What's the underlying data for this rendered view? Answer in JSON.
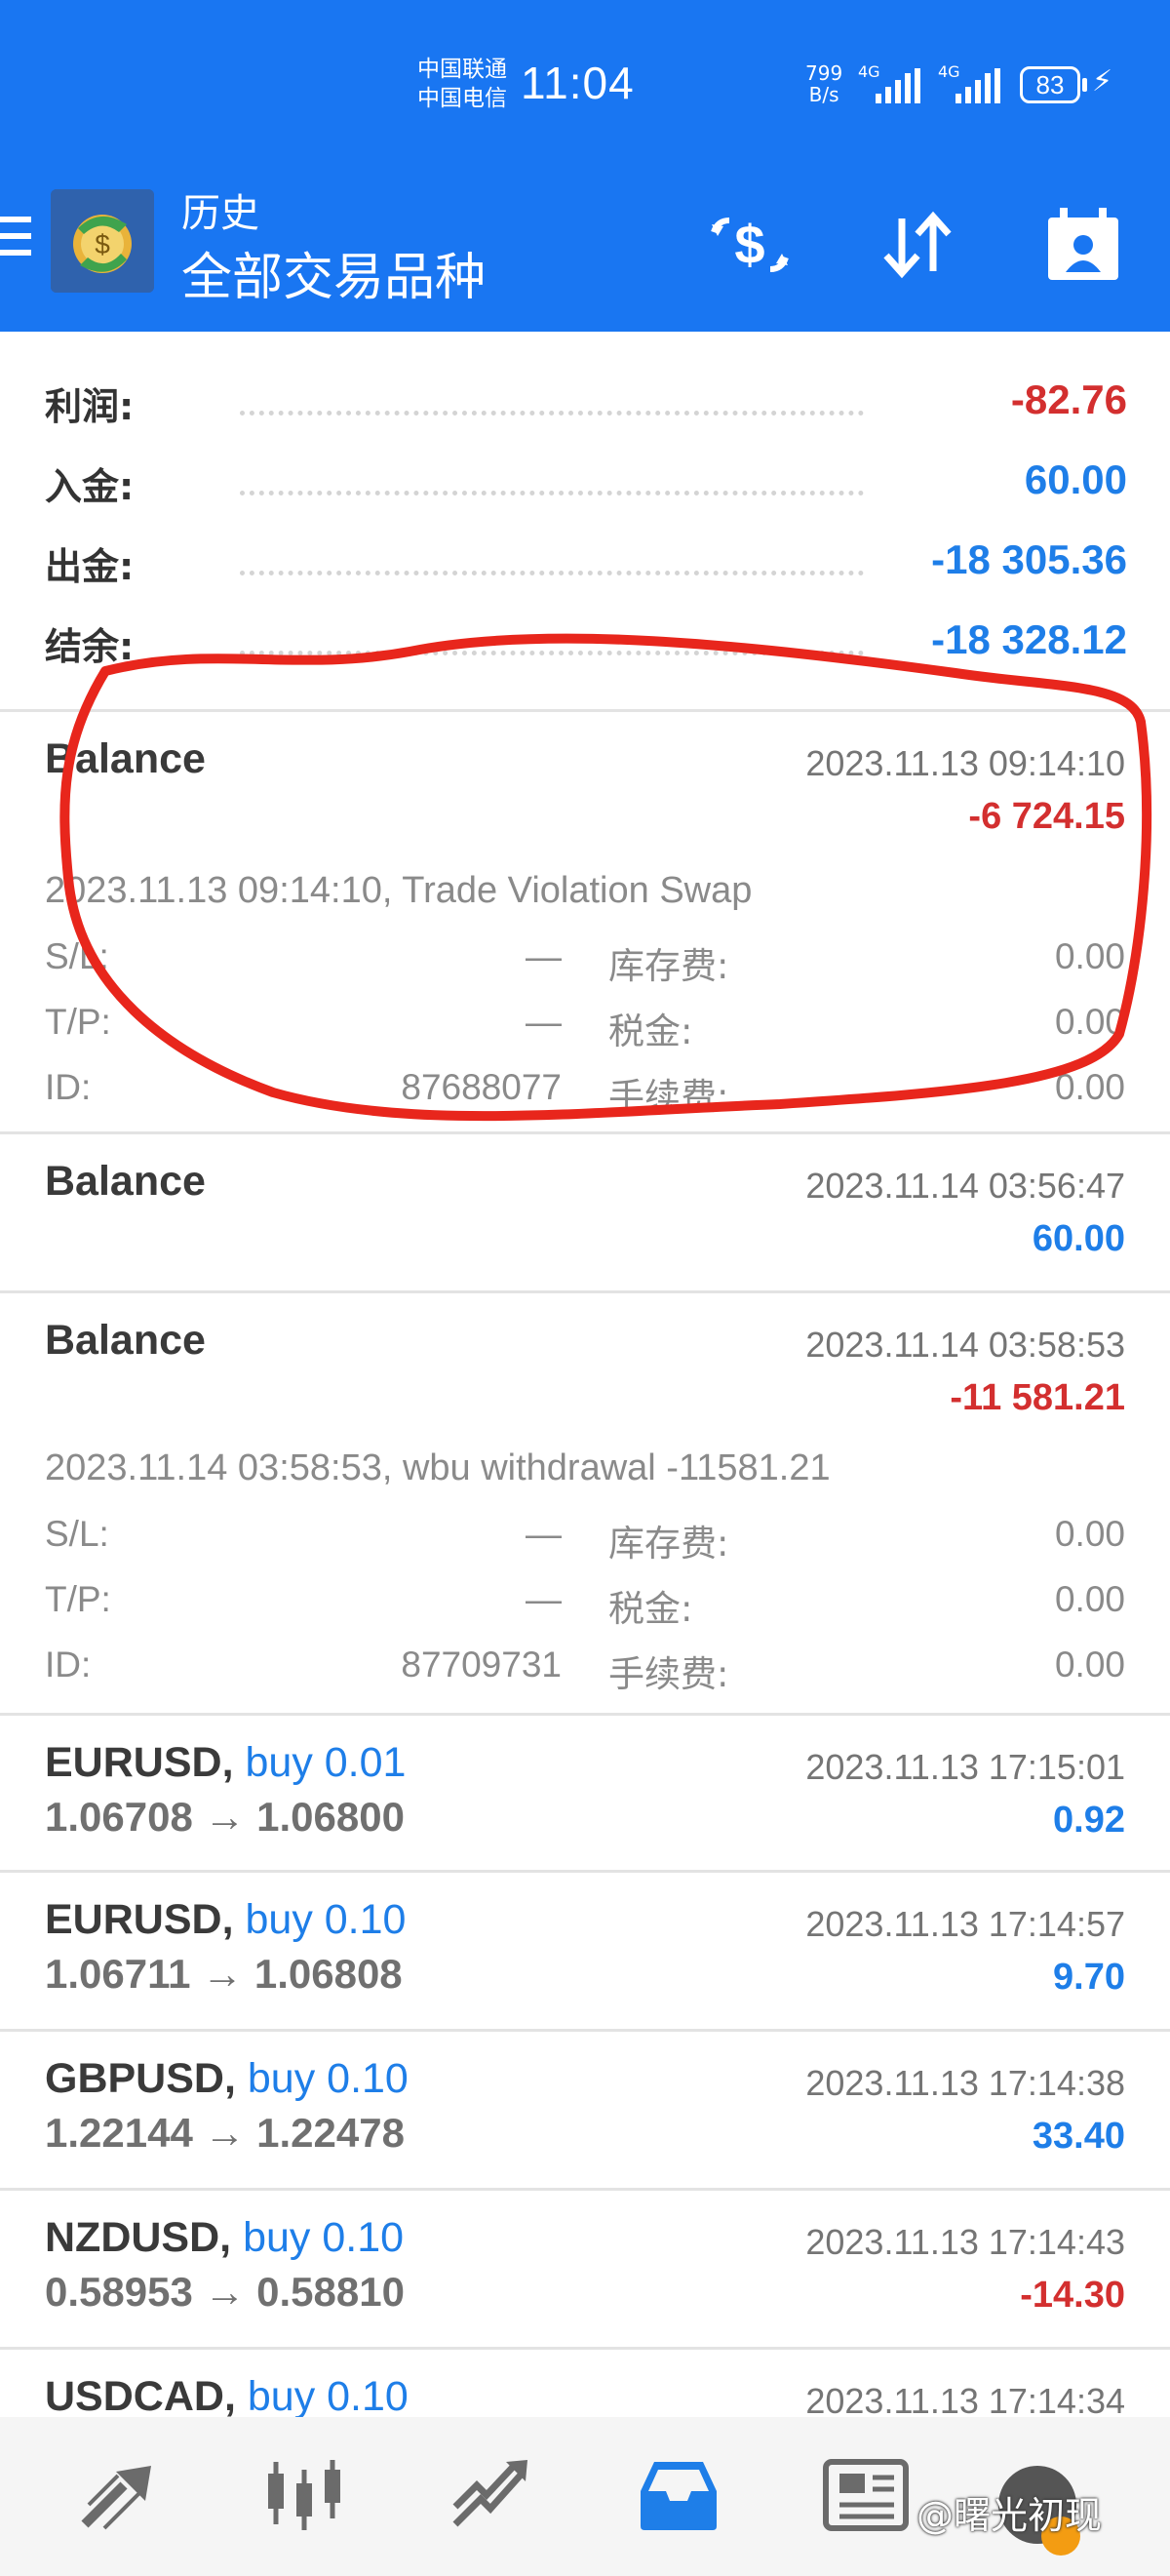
{
  "status_bar": {
    "carrier_1": "中国联通",
    "carrier_2": "中国电信",
    "time": "11:04",
    "net_speed_value": "799",
    "net_speed_unit": "B/s",
    "signal_1_tag": "4G",
    "signal_2_tag": "4G",
    "battery": "83",
    "charging_icon": "bolt-icon"
  },
  "app_bar": {
    "subtitle": "历史",
    "title": "全部交易品种",
    "icons": [
      "menu-icon",
      "app-logo",
      "dollar-swap-icon",
      "sort-icon",
      "calendar-icon"
    ]
  },
  "summary": [
    {
      "label": "利润:",
      "value": "-82.76",
      "tone": "neg"
    },
    {
      "label": "入金:",
      "value": "60.00",
      "tone": "pos"
    },
    {
      "label": "出金:",
      "value": "-18 305.36",
      "tone": "pos"
    },
    {
      "label": "结余:",
      "value": "-18 328.12",
      "tone": "pos"
    }
  ],
  "deals": [
    {
      "title": "Balance",
      "time": "2023.11.13 09:14:10",
      "profit": "-6 724.15",
      "tone": "neg",
      "comment": "2023.11.13 09:14:10, Trade Violation Swap",
      "details": {
        "sl_label": "S/L:",
        "sl_value": "—",
        "swap_label": "库存费:",
        "swap_value": "0.00",
        "tp_label": "T/P:",
        "tp_value": "—",
        "tax_label": "税金:",
        "tax_value": "0.00",
        "id_label": "ID:",
        "id_value": "87688077",
        "fee_label": "手续费:",
        "fee_value": "0.00"
      }
    },
    {
      "title": "Balance",
      "time": "2023.11.14 03:56:47",
      "profit": "60.00",
      "tone": "pos"
    },
    {
      "title": "Balance",
      "time": "2023.11.14 03:58:53",
      "profit": "-11 581.21",
      "tone": "neg",
      "comment": "2023.11.14 03:58:53, wbu withdrawal -11581.21",
      "details": {
        "sl_label": "S/L:",
        "sl_value": "—",
        "swap_label": "库存费:",
        "swap_value": "0.00",
        "tp_label": "T/P:",
        "tp_value": "—",
        "tax_label": "税金:",
        "tax_value": "0.00",
        "id_label": "ID:",
        "id_value": "87709731",
        "fee_label": "手续费:",
        "fee_value": "0.00"
      }
    }
  ],
  "trades": [
    {
      "symbol": "EURUSD,",
      "side": "buy 0.01",
      "prices": "1.06708 → 1.06800",
      "time": "2023.11.13 17:15:01",
      "profit": "0.92",
      "tone": "pos"
    },
    {
      "symbol": "EURUSD,",
      "side": "buy 0.10",
      "prices": "1.06711 → 1.06808",
      "time": "2023.11.13 17:14:57",
      "profit": "9.70",
      "tone": "pos"
    },
    {
      "symbol": "GBPUSD,",
      "side": "buy 0.10",
      "prices": "1.22144 → 1.22478",
      "time": "2023.11.13 17:14:38",
      "profit": "33.40",
      "tone": "pos"
    },
    {
      "symbol": "NZDUSD,",
      "side": "buy 0.10",
      "prices": "0.58953 → 0.58810",
      "time": "2023.11.13 17:14:43",
      "profit": "-14.30",
      "tone": "neg"
    },
    {
      "symbol": "USDCAD,",
      "side": "buy 0.10",
      "prices": "",
      "time": "2023.11.13 17:14:34",
      "profit": "",
      "tone": "pos"
    }
  ],
  "bottom_nav": {
    "items": [
      "quotes-icon",
      "chart-icon",
      "trade-icon",
      "history-icon",
      "news-icon",
      "messages-icon"
    ],
    "active": "history-icon"
  },
  "watermark": "@曙光初现",
  "colors": {
    "brand_blue": "#1976f2",
    "positive": "#1e7ee8",
    "negative": "#d32f2f",
    "annotation_red": "#e8261c",
    "nav_active": "#1e7ee8",
    "nav_inactive": "#6b6b6b"
  }
}
